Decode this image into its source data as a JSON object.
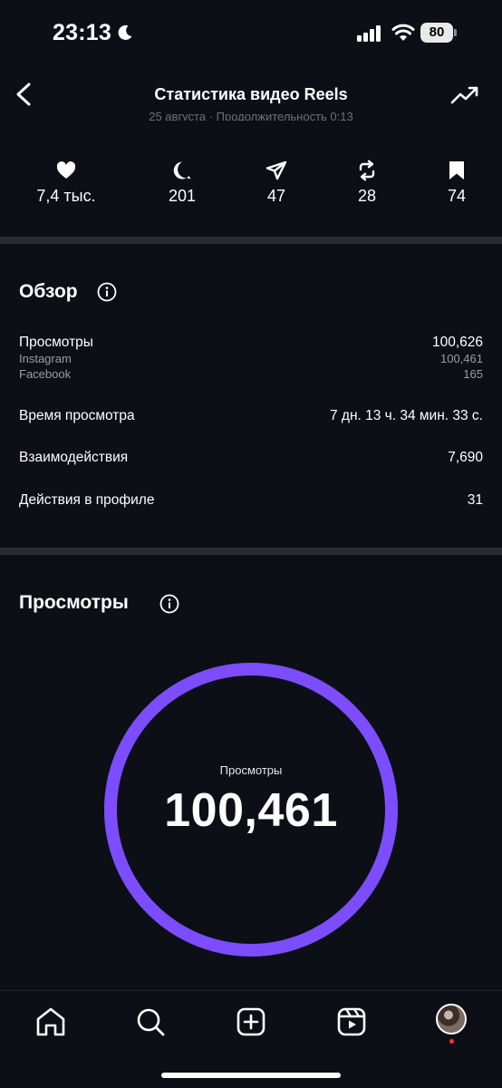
{
  "status_bar": {
    "time": "23:13",
    "battery": "80",
    "icons": [
      "moon-icon",
      "signal-icon",
      "wifi-icon",
      "battery-icon"
    ]
  },
  "header": {
    "title": "Статистика видео Reels",
    "back_icon": "chevron-left-icon",
    "trend_icon": "trending-up-icon",
    "clipped_subtitle": "25 августа · Продолжительность 0:13"
  },
  "metrics": [
    {
      "icon": "heart-icon",
      "value": "7,4 тыс."
    },
    {
      "icon": "comment-icon",
      "value": "201"
    },
    {
      "icon": "send-icon",
      "value": "47"
    },
    {
      "icon": "repost-icon",
      "value": "28"
    },
    {
      "icon": "bookmark-icon",
      "value": "74"
    }
  ],
  "overview": {
    "title": "Обзор",
    "rows": [
      {
        "label": "Просмотры",
        "value": "100,626"
      },
      {
        "label": "Instagram",
        "value": "100,461"
      },
      {
        "label": "Facebook",
        "value": "165"
      },
      {
        "label": "Время просмотра",
        "value": "7 дн. 13 ч. 34 мин. 33 с."
      },
      {
        "label": "Взаимодействия",
        "value": "7,690"
      },
      {
        "label": "Действия в профиле",
        "value": "31"
      }
    ]
  },
  "views": {
    "title": "Просмотры",
    "donut_label": "Просмотры",
    "donut_value": "100,461",
    "ring_fill_fraction": 1.0,
    "ring_color": "#7b4dff"
  },
  "tabbar": {
    "items": [
      "home-icon",
      "search-icon",
      "create-icon",
      "reels-icon",
      "profile-avatar"
    ]
  },
  "colors": {
    "background": "#0d0f16",
    "divider": "#2a2c33",
    "accent": "#7b4dff",
    "notification": "#ff3040"
  }
}
